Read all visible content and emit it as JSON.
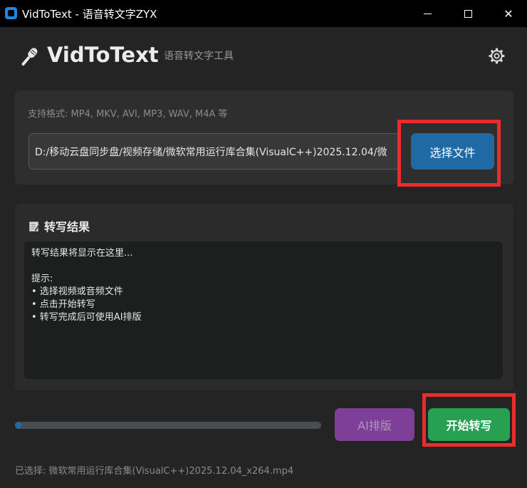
{
  "window": {
    "title": "VidToText - 语音转文字ZYX",
    "controls": {
      "minimize": "minimize",
      "maximize": "maximize",
      "close": "✕"
    }
  },
  "header": {
    "app_name": "VidToText",
    "subtitle": "语音转文字工具",
    "icons": {
      "logo": "microphone-icon",
      "settings": "gear-icon"
    }
  },
  "file_section": {
    "formats_label": "支持格式: MP4, MKV, AVI, MP3, WAV, M4A 等",
    "path_value": "D:/移动云盘同步盘/视频存储/微软常用运行库合集(VisualC++)2025.12.04/微",
    "choose_button": "选择文件"
  },
  "result_section": {
    "title": "转写结果",
    "icon": "memo-icon",
    "lines": [
      "转写结果将显示在这里...",
      "",
      "提示:",
      "• 选择视频或音频文件",
      "• 点击开始转写",
      "• 转写完成后可使用AI排版"
    ]
  },
  "actions": {
    "progress": 0.02,
    "ai_button": "AI排版",
    "start_button": "开始转写"
  },
  "status": {
    "selected": "已选择: 微软常用运行库合集(VisualC++)2025.12.04_x264.mp4"
  },
  "colors": {
    "background": "#242424",
    "accent_blue": "#1f6aa5",
    "ai_purple": "#8e44ad",
    "start_green": "#27a052",
    "highlight_red": "#ec2b2b"
  }
}
